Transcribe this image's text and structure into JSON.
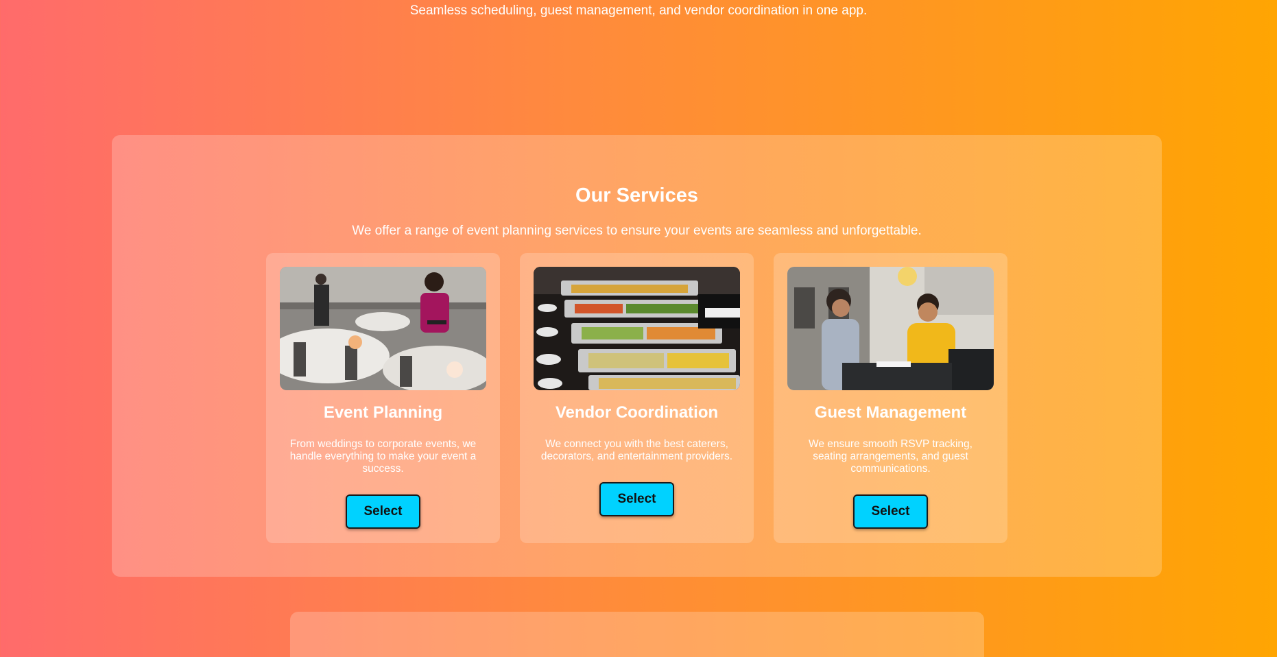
{
  "hero": {
    "subtitle": "Seamless scheduling, guest management, and vendor coordination in one app."
  },
  "services": {
    "title": "Our Services",
    "description": "We offer a range of event planning services to ensure your events are seamless and unforgettable.",
    "cards": [
      {
        "title": "Event Planning",
        "text": "From weddings to corporate events, we handle everything to make your event a success.",
        "button_label": "Select",
        "image_icon": "banquet-hall-photo"
      },
      {
        "title": "Vendor Coordination",
        "text": "We connect you with the best caterers, decorators, and entertainment providers.",
        "button_label": "Select",
        "image_icon": "catering-buffet-photo"
      },
      {
        "title": "Guest Management",
        "text": "We ensure smooth RSVP tracking, seating arrangements, and guest communications.",
        "button_label": "Select",
        "image_icon": "guest-meeting-photo"
      }
    ]
  },
  "colors": {
    "background_start": "#ff6b6b",
    "background_end": "#ffa502",
    "button": "#00d2ff"
  }
}
